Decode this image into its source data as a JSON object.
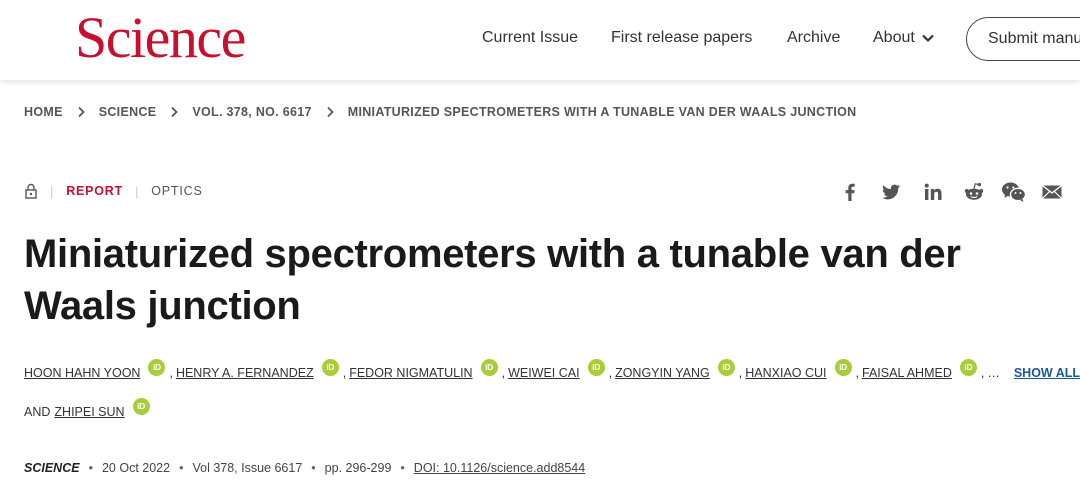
{
  "header": {
    "logo": "Science",
    "nav": [
      "Current Issue",
      "First release papers",
      "Archive",
      "About"
    ],
    "submit_label": "Submit manu"
  },
  "breadcrumb": [
    "HOME",
    "SCIENCE",
    "VOL. 378, NO. 6617",
    "MINIATURIZED SPECTROMETERS WITH A TUNABLE VAN DER WAALS JUNCTION"
  ],
  "meta": {
    "type": "REPORT",
    "section": "OPTICS"
  },
  "share_icons": [
    "facebook-icon",
    "twitter-icon",
    "linkedin-icon",
    "reddit-icon",
    "wechat-icon",
    "email-icon"
  ],
  "title": "Miniaturized spectrometers with a tunable van der Waals junction",
  "authors": {
    "list": [
      "HOON HAHN YOON",
      "HENRY A. FERNANDEZ",
      "FEDOR NIGMATULIN",
      "WEIWEI CAI",
      "ZONGYIN YANG",
      "HANXIAO CUI",
      "FAISAL AHMED"
    ],
    "ellipsis": "…",
    "show_all": "SHOW ALL",
    "ellipsis_after": "…",
    "and_label": "AND",
    "last": "ZHIPEI SUN",
    "orcid_label": "iD"
  },
  "citation": {
    "journal": "SCIENCE",
    "date": "20 Oct 2022",
    "volume": "Vol 378, Issue 6617",
    "pages": "pp. 296-299",
    "doi": "DOI: 10.1126/science.add8544"
  },
  "colors": {
    "brand": "#c8102e",
    "orcid": "#a6ce39",
    "link": "#1a57a6"
  }
}
